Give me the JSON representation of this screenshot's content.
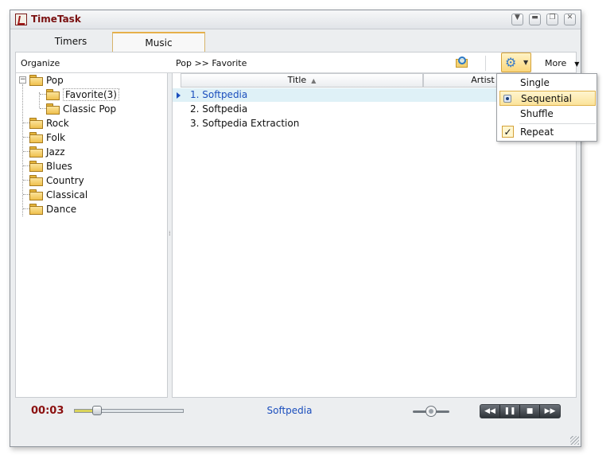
{
  "window": {
    "title": "TimeTask"
  },
  "window_controls": {
    "dropdown": "▼",
    "minimize": "▬",
    "restore": "❐",
    "close": "✕"
  },
  "tabs": [
    {
      "label": "Timers",
      "active": false
    },
    {
      "label": "Music",
      "active": true
    }
  ],
  "toolbar": {
    "organize_label": "Organize",
    "breadcrumb": "Pop >> Favorite",
    "more_label": "More",
    "caret": "▼",
    "gear_glyph": "⚙"
  },
  "tree": {
    "expander": "−",
    "items": [
      {
        "label": "Pop",
        "level": 0
      },
      {
        "label": "Favorite(3)",
        "level": 1,
        "selected": true
      },
      {
        "label": "Classic Pop",
        "level": 1
      },
      {
        "label": "Rock",
        "level": 0
      },
      {
        "label": "Folk",
        "level": 0
      },
      {
        "label": "Jazz",
        "level": 0
      },
      {
        "label": "Blues",
        "level": 0
      },
      {
        "label": "Country",
        "level": 0
      },
      {
        "label": "Classical",
        "level": 0
      },
      {
        "label": "Dance",
        "level": 0
      }
    ]
  },
  "grid": {
    "columns": [
      {
        "label": "Title",
        "sort": "▲"
      },
      {
        "label": "Artist"
      }
    ],
    "rows": [
      {
        "title": "1. Softpedia",
        "playing": true
      },
      {
        "title": "2. Softpedia"
      },
      {
        "title": "3. Softpedia Extraction"
      }
    ]
  },
  "playback_menu": {
    "items": [
      {
        "label": "Single"
      },
      {
        "label": "Sequential",
        "selected": true
      },
      {
        "label": "Shuffle"
      },
      {
        "label": "Repeat",
        "checked": true,
        "check_glyph": "✓"
      }
    ]
  },
  "player": {
    "elapsed": "00:03",
    "now_playing": "Softpedia",
    "seek_fraction": 0.18,
    "volume_fraction": 0.5,
    "buttons": {
      "rewind": "◀◀",
      "pause": "❚❚",
      "stop": "■",
      "forward": "▶▶"
    }
  },
  "colors": {
    "accent_blue": "#1b4ebd",
    "time_red": "#8b1010",
    "highlight_gold": "#fbe39a",
    "playing_row": "#dff1f7"
  }
}
